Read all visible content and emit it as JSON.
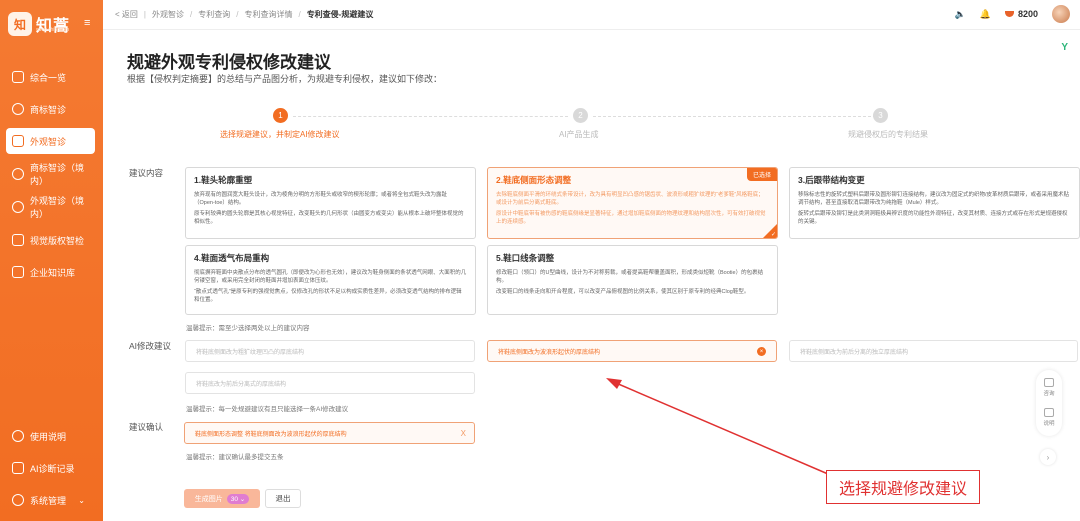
{
  "app": {
    "logo_badge": "知",
    "logo_text": "知蒿",
    "logo_sub": "www.zhihi.com"
  },
  "sidebar": {
    "items": [
      {
        "label": "综合一览",
        "icon": "home-icon"
      },
      {
        "label": "商标智诊",
        "icon": "shield-icon"
      },
      {
        "label": "外观智诊",
        "icon": "design-icon",
        "active": true
      },
      {
        "label": "商标智诊（境内）",
        "icon": "shield-check-icon"
      },
      {
        "label": "外观智诊（境内）",
        "icon": "shield-icon"
      },
      {
        "label": "视觉版权智检",
        "icon": "image-icon"
      },
      {
        "label": "企业知识库",
        "icon": "database-icon"
      }
    ],
    "bottom": [
      {
        "label": "使用说明",
        "icon": "help-icon"
      },
      {
        "label": "AI诊断记录",
        "icon": "record-icon"
      },
      {
        "label": "系统管理",
        "icon": "settings-icon"
      }
    ]
  },
  "topbar": {
    "back": "< 返回",
    "crumbs": [
      "外观智诊",
      "专利查询",
      "专利查询详情",
      "专利查侵-规避建议"
    ],
    "points": "8200"
  },
  "page": {
    "title": "规避外观专利侵权修改建议",
    "subtitle": "根据【侵权判定摘要】的总结与产品图分析，为规避专利侵权，建议如下修改：",
    "y_mark": "Y"
  },
  "steps": [
    {
      "num": "1",
      "label": "选择规避建议，并制定AI修改建议"
    },
    {
      "num": "2",
      "label": "AI产品生成"
    },
    {
      "num": "3",
      "label": "规避侵权后的专利结果"
    }
  ],
  "labels": {
    "suggest": "建议内容",
    "ai": "AI修改建议",
    "confirm": "建议确认"
  },
  "cards": [
    {
      "title": "1.鞋头轮廓重塑",
      "p1": "放弃现有的圆润宽大鞋头设计，改为棱角分明的方形鞋头或收窄的楔形轮廓；或者将全包式鞋头改为露趾（Open-toe）结构。",
      "p2": "原专利较典的圆头轮廓是其核心视觉特征，改变鞋头的几何形状（由圆变方或变尖）能从根本上破坏整体视觉的相似性。",
      "selected": false
    },
    {
      "title": "2.鞋底侧面形态调整",
      "p1": "去除鞋底侧面平滑的环绕式条带设计，改为具有明显凹凸感的锯齿状、波浪形或粗犷纹理的“老爹鞋”风格鞋底；或设计为前后分离式鞋底。",
      "p2": "原设计中鞋底带有被伤感的鞋底侧缘是显著特征，通过增加鞋底侧面的物理纹理和结构层次性，可有效打破视觉上的连续感。",
      "selected": true,
      "badge": "已选择"
    },
    {
      "title": "3.后跟带结构变更",
      "p1": "移除标志性的旋转式塑料后跟带及圆形铆钉连接结构，建议改为固定式的织物/皮革材质后跟带，或者采用魔术贴调节结构，甚至直接取消后跟带改为纯拖鞋（Mule）样式。",
      "p2": "旋转式后跟带及铆钉是此类洞洞鞋极具辨识度的功能性外观特征，改变其材质、连接方式或存在形式是规避侵权的关键。",
      "selected": false
    },
    {
      "title": "4.鞋面透气布局重构",
      "p1": "彻底摒弃鞋面中央散点分布的透气圆孔（即便改为心形也无效），建议改为鞋身侧面的条状透气网眼、大面积的几何镂空窗，或采用完全封闭的鞋面并增加表面立体压纹。",
      "p2": "“散点式透气孔”是原专利的强视觉焦点，仅修改孔的形状不足以构成实质性差异，必须改变透气结构的排布逻辑和位置。",
      "selected": false
    },
    {
      "title": "5.鞋口线条调整",
      "p1": "修改鞋口（领口）的U型曲线，设计为不对称剪裁，或者提高鞋帮覆盖面积，形成类似短靴（Bootie）的包裹结构。",
      "p2": "改变鞋口的线条走向和开合程度，可以改变产品俯视图的比例关系，使其区别于原专利的经典Clog鞋型。",
      "selected": false
    }
  ],
  "hints": {
    "suggest": "温馨提示：需至少选择两处以上的建议内容",
    "ai": "温馨提示：每一处规避建议有且只能选择一条AI修改建议",
    "confirm": "温馨提示：建议确认最多提交五条"
  },
  "ai_options": [
    {
      "text": "将鞋底侧面改为粗犷纹理凹凸的厚底结构",
      "selected": false
    },
    {
      "text": "将鞋底侧面改为波浪形起伏的厚底结构",
      "selected": true
    },
    {
      "text": "将鞋底侧面改为前后分离的独立厚底结构",
      "selected": false
    },
    {
      "text": "将鞋底改为前后分离式的厚底结构",
      "selected": false
    }
  ],
  "confirm": {
    "text": "鞋底侧面形态调整  将鞋底侧面改为波浪形起伏的厚底结构",
    "x": "X"
  },
  "buttons": {
    "generate": "生成图片",
    "count": "30",
    "exit": "退出"
  },
  "float": {
    "consult": "咨询",
    "guide": "说明",
    "arrow": "›"
  },
  "annotation": {
    "text": "选择规避修改建议",
    "color": "#e03131"
  },
  "colors": {
    "accent": "#f26d22",
    "annotation": "#e03131"
  }
}
